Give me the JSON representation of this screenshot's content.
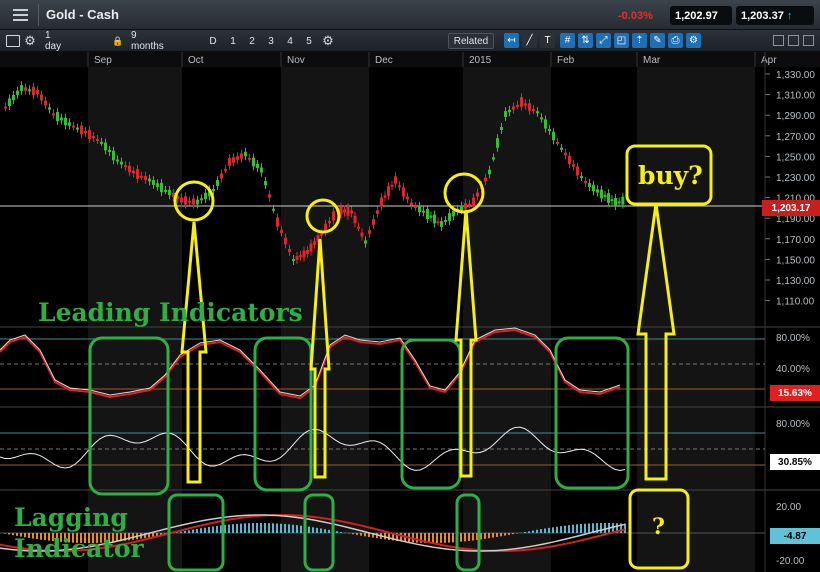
{
  "header": {
    "title": "Gold - Cash",
    "change_pct": "-0.03%",
    "bid": "1,202.97",
    "ask": "1,203.37"
  },
  "toolbar": {
    "interval": "1 day",
    "range": "9 months",
    "period_buttons": [
      "D",
      "1",
      "2",
      "3",
      "4",
      "5"
    ],
    "related_label": "Related"
  },
  "chart": {
    "months": [
      "Sep",
      "Oct",
      "Nov",
      "Dec",
      "2015",
      "Feb",
      "Mar",
      "Apr"
    ],
    "price_ticks": [
      "1,330.00",
      "1,310.00",
      "1,290.00",
      "1,270.00",
      "1,250.00",
      "1,230.00",
      "1,210.00",
      "1,190.00",
      "1,170.00",
      "1,150.00",
      "1,130.00",
      "1,110.00"
    ],
    "current_price": "1,203.17",
    "osc1_ticks": [
      "80.00%",
      "40.00%"
    ],
    "osc1_value": "15.63%",
    "osc2_ticks": [
      "80.00%"
    ],
    "osc2_value": "30.85%",
    "macd_ticks": [
      "20.00",
      "-20.00"
    ],
    "macd_value": "-4.87"
  },
  "annotations": {
    "leading": "Leading Indicators",
    "lagging_line1": "Lagging",
    "lagging_line2": "Indicator",
    "buy": "buy?",
    "question": "?"
  },
  "colors": {
    "green_box": "#2fae47",
    "yellow": "#f5ef16",
    "up_candle": "#2ec42e",
    "down_candle": "#e0262c",
    "histogram_up": "#58b8d0",
    "histogram_down": "#f08a1e"
  }
}
